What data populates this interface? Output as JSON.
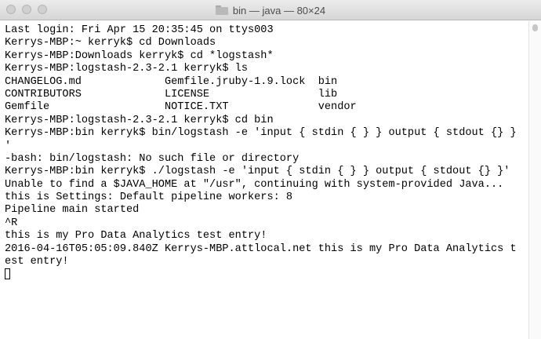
{
  "window": {
    "title": "bin — java — 80×24"
  },
  "terminal": {
    "lines": [
      "Last login: Fri Apr 15 20:35:45 on ttys003",
      "Kerrys-MBP:~ kerryk$ cd Downloads",
      "Kerrys-MBP:Downloads kerryk$ cd *logstash*",
      "Kerrys-MBP:logstash-2.3-2.1 kerryk$ ls",
      "CHANGELOG.md             Gemfile.jruby-1.9.lock  bin",
      "CONTRIBUTORS             LICENSE                 lib",
      "Gemfile                  NOTICE.TXT              vendor",
      "Kerrys-MBP:logstash-2.3-2.1 kerryk$ cd bin",
      "Kerrys-MBP:bin kerryk$ bin/logstash -e 'input { stdin { } } output { stdout {} }",
      "'",
      "-bash: bin/logstash: No such file or directory",
      "Kerrys-MBP:bin kerryk$ ./logstash -e 'input { stdin { } } output { stdout {} }'",
      "Unable to find a $JAVA_HOME at \"/usr\", continuing with system-provided Java...",
      "this is Settings: Default pipeline workers: 8",
      "Pipeline main started",
      "^R",
      "this is my Pro Data Analytics test entry!",
      "2016-04-16T05:05:09.840Z Kerrys-MBP.attlocal.net this is my Pro Data Analytics t",
      "est entry!"
    ]
  }
}
